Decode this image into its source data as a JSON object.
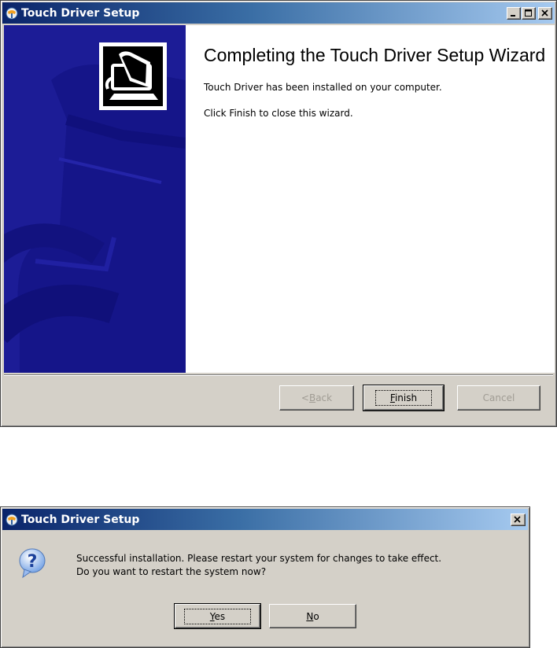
{
  "wizard": {
    "title": "Touch Driver Setup",
    "heading": "Completing the Touch Driver Setup Wizard",
    "message_installed": "Touch Driver has been installed on your computer.",
    "message_finish": "Click Finish to close this wizard.",
    "buttons": {
      "back_prefix": "< ",
      "back_access": "B",
      "back_rest": "ack",
      "finish_access": "F",
      "finish_rest": "inish",
      "cancel": "Cancel"
    },
    "back_enabled": false,
    "cancel_enabled": false
  },
  "dialog": {
    "title": "Touch Driver Setup",
    "icon": "question-icon",
    "message_line1": "Successful installation. Please restart your system for changes to take effect.",
    "message_line2": "Do you want to restart the system now?",
    "buttons": {
      "yes_access": "Y",
      "yes_rest": "es",
      "no_access": "N",
      "no_rest": "o"
    }
  },
  "colors": {
    "titlebar_start": "#0a246a",
    "titlebar_end": "#a6caf0",
    "sidepanel": "#1c1c96",
    "dialog_face": "#d4d0c8"
  }
}
